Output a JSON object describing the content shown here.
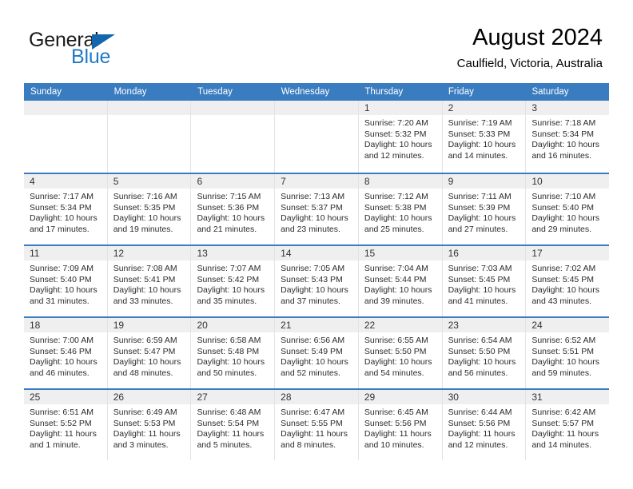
{
  "brand": {
    "name_part1": "General",
    "name_part2": "Blue",
    "triangle_icon": "triangle-icon",
    "accent_color": "#1266ad",
    "text_color": "#1f7ac4"
  },
  "header": {
    "title": "August 2024",
    "subtitle": "Caulfield, Victoria, Australia"
  },
  "calendar": {
    "header_bg": "#3a7cc0",
    "weekdays": [
      "Sunday",
      "Monday",
      "Tuesday",
      "Wednesday",
      "Thursday",
      "Friday",
      "Saturday"
    ],
    "weeks": [
      [
        {
          "day": "",
          "sunrise": "",
          "sunset": "",
          "daylight_line1": "",
          "daylight_line2": "",
          "empty": true
        },
        {
          "day": "",
          "sunrise": "",
          "sunset": "",
          "daylight_line1": "",
          "daylight_line2": "",
          "empty": true
        },
        {
          "day": "",
          "sunrise": "",
          "sunset": "",
          "daylight_line1": "",
          "daylight_line2": "",
          "empty": true
        },
        {
          "day": "",
          "sunrise": "",
          "sunset": "",
          "daylight_line1": "",
          "daylight_line2": "",
          "empty": true
        },
        {
          "day": "1",
          "sunrise": "Sunrise: 7:20 AM",
          "sunset": "Sunset: 5:32 PM",
          "daylight_line1": "Daylight: 10 hours",
          "daylight_line2": "and 12 minutes."
        },
        {
          "day": "2",
          "sunrise": "Sunrise: 7:19 AM",
          "sunset": "Sunset: 5:33 PM",
          "daylight_line1": "Daylight: 10 hours",
          "daylight_line2": "and 14 minutes."
        },
        {
          "day": "3",
          "sunrise": "Sunrise: 7:18 AM",
          "sunset": "Sunset: 5:34 PM",
          "daylight_line1": "Daylight: 10 hours",
          "daylight_line2": "and 16 minutes."
        }
      ],
      [
        {
          "day": "4",
          "sunrise": "Sunrise: 7:17 AM",
          "sunset": "Sunset: 5:34 PM",
          "daylight_line1": "Daylight: 10 hours",
          "daylight_line2": "and 17 minutes."
        },
        {
          "day": "5",
          "sunrise": "Sunrise: 7:16 AM",
          "sunset": "Sunset: 5:35 PM",
          "daylight_line1": "Daylight: 10 hours",
          "daylight_line2": "and 19 minutes."
        },
        {
          "day": "6",
          "sunrise": "Sunrise: 7:15 AM",
          "sunset": "Sunset: 5:36 PM",
          "daylight_line1": "Daylight: 10 hours",
          "daylight_line2": "and 21 minutes."
        },
        {
          "day": "7",
          "sunrise": "Sunrise: 7:13 AM",
          "sunset": "Sunset: 5:37 PM",
          "daylight_line1": "Daylight: 10 hours",
          "daylight_line2": "and 23 minutes."
        },
        {
          "day": "8",
          "sunrise": "Sunrise: 7:12 AM",
          "sunset": "Sunset: 5:38 PM",
          "daylight_line1": "Daylight: 10 hours",
          "daylight_line2": "and 25 minutes."
        },
        {
          "day": "9",
          "sunrise": "Sunrise: 7:11 AM",
          "sunset": "Sunset: 5:39 PM",
          "daylight_line1": "Daylight: 10 hours",
          "daylight_line2": "and 27 minutes."
        },
        {
          "day": "10",
          "sunrise": "Sunrise: 7:10 AM",
          "sunset": "Sunset: 5:40 PM",
          "daylight_line1": "Daylight: 10 hours",
          "daylight_line2": "and 29 minutes."
        }
      ],
      [
        {
          "day": "11",
          "sunrise": "Sunrise: 7:09 AM",
          "sunset": "Sunset: 5:40 PM",
          "daylight_line1": "Daylight: 10 hours",
          "daylight_line2": "and 31 minutes."
        },
        {
          "day": "12",
          "sunrise": "Sunrise: 7:08 AM",
          "sunset": "Sunset: 5:41 PM",
          "daylight_line1": "Daylight: 10 hours",
          "daylight_line2": "and 33 minutes."
        },
        {
          "day": "13",
          "sunrise": "Sunrise: 7:07 AM",
          "sunset": "Sunset: 5:42 PM",
          "daylight_line1": "Daylight: 10 hours",
          "daylight_line2": "and 35 minutes."
        },
        {
          "day": "14",
          "sunrise": "Sunrise: 7:05 AM",
          "sunset": "Sunset: 5:43 PM",
          "daylight_line1": "Daylight: 10 hours",
          "daylight_line2": "and 37 minutes."
        },
        {
          "day": "15",
          "sunrise": "Sunrise: 7:04 AM",
          "sunset": "Sunset: 5:44 PM",
          "daylight_line1": "Daylight: 10 hours",
          "daylight_line2": "and 39 minutes."
        },
        {
          "day": "16",
          "sunrise": "Sunrise: 7:03 AM",
          "sunset": "Sunset: 5:45 PM",
          "daylight_line1": "Daylight: 10 hours",
          "daylight_line2": "and 41 minutes."
        },
        {
          "day": "17",
          "sunrise": "Sunrise: 7:02 AM",
          "sunset": "Sunset: 5:45 PM",
          "daylight_line1": "Daylight: 10 hours",
          "daylight_line2": "and 43 minutes."
        }
      ],
      [
        {
          "day": "18",
          "sunrise": "Sunrise: 7:00 AM",
          "sunset": "Sunset: 5:46 PM",
          "daylight_line1": "Daylight: 10 hours",
          "daylight_line2": "and 46 minutes."
        },
        {
          "day": "19",
          "sunrise": "Sunrise: 6:59 AM",
          "sunset": "Sunset: 5:47 PM",
          "daylight_line1": "Daylight: 10 hours",
          "daylight_line2": "and 48 minutes."
        },
        {
          "day": "20",
          "sunrise": "Sunrise: 6:58 AM",
          "sunset": "Sunset: 5:48 PM",
          "daylight_line1": "Daylight: 10 hours",
          "daylight_line2": "and 50 minutes."
        },
        {
          "day": "21",
          "sunrise": "Sunrise: 6:56 AM",
          "sunset": "Sunset: 5:49 PM",
          "daylight_line1": "Daylight: 10 hours",
          "daylight_line2": "and 52 minutes."
        },
        {
          "day": "22",
          "sunrise": "Sunrise: 6:55 AM",
          "sunset": "Sunset: 5:50 PM",
          "daylight_line1": "Daylight: 10 hours",
          "daylight_line2": "and 54 minutes."
        },
        {
          "day": "23",
          "sunrise": "Sunrise: 6:54 AM",
          "sunset": "Sunset: 5:50 PM",
          "daylight_line1": "Daylight: 10 hours",
          "daylight_line2": "and 56 minutes."
        },
        {
          "day": "24",
          "sunrise": "Sunrise: 6:52 AM",
          "sunset": "Sunset: 5:51 PM",
          "daylight_line1": "Daylight: 10 hours",
          "daylight_line2": "and 59 minutes."
        }
      ],
      [
        {
          "day": "25",
          "sunrise": "Sunrise: 6:51 AM",
          "sunset": "Sunset: 5:52 PM",
          "daylight_line1": "Daylight: 11 hours",
          "daylight_line2": "and 1 minute."
        },
        {
          "day": "26",
          "sunrise": "Sunrise: 6:49 AM",
          "sunset": "Sunset: 5:53 PM",
          "daylight_line1": "Daylight: 11 hours",
          "daylight_line2": "and 3 minutes."
        },
        {
          "day": "27",
          "sunrise": "Sunrise: 6:48 AM",
          "sunset": "Sunset: 5:54 PM",
          "daylight_line1": "Daylight: 11 hours",
          "daylight_line2": "and 5 minutes."
        },
        {
          "day": "28",
          "sunrise": "Sunrise: 6:47 AM",
          "sunset": "Sunset: 5:55 PM",
          "daylight_line1": "Daylight: 11 hours",
          "daylight_line2": "and 8 minutes."
        },
        {
          "day": "29",
          "sunrise": "Sunrise: 6:45 AM",
          "sunset": "Sunset: 5:56 PM",
          "daylight_line1": "Daylight: 11 hours",
          "daylight_line2": "and 10 minutes."
        },
        {
          "day": "30",
          "sunrise": "Sunrise: 6:44 AM",
          "sunset": "Sunset: 5:56 PM",
          "daylight_line1": "Daylight: 11 hours",
          "daylight_line2": "and 12 minutes."
        },
        {
          "day": "31",
          "sunrise": "Sunrise: 6:42 AM",
          "sunset": "Sunset: 5:57 PM",
          "daylight_line1": "Daylight: 11 hours",
          "daylight_line2": "and 14 minutes."
        }
      ]
    ]
  }
}
